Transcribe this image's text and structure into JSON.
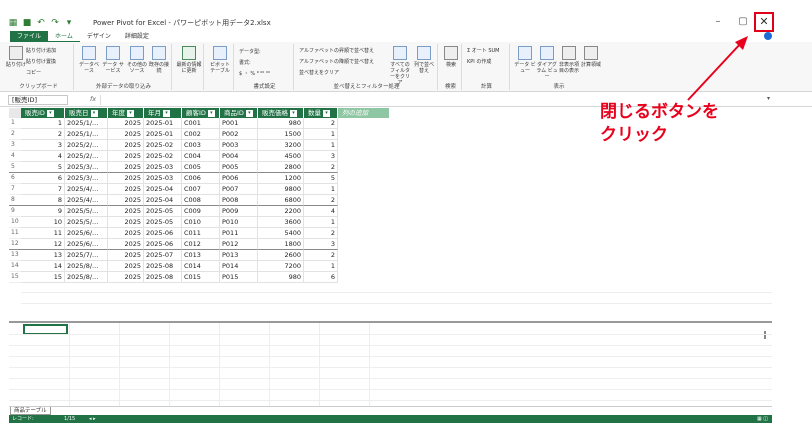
{
  "window": {
    "title": "Power Pivot for Excel - パワーピボット用データ2.xlsx",
    "minimize": "–",
    "restore": "▢",
    "close": "✕"
  },
  "tabs": [
    "ファイル",
    "ホーム",
    "デザイン",
    "詳細設定"
  ],
  "ribbon": {
    "clipboard": {
      "paste": "貼り付け",
      "append": "貼り付け追加",
      "replace": "貼り付け置換",
      "copy": "コピー",
      "label": "クリップボード"
    },
    "external": {
      "db": "データベース",
      "service": "データ サービス",
      "other": "その他のソース",
      "existing": "既存の接続",
      "label": "外部データの取り込み"
    },
    "refresh": {
      "label": "最新の情報に更新"
    },
    "pivot": {
      "label": "ピボットテーブル"
    },
    "format": {
      "type": "データ型:",
      "fmt": "書式:",
      "currency": "$ ・ % ⁹ ⁰⁰ ⁰⁰",
      "label": "書式設定"
    },
    "sort": {
      "asc": "アルファベットの昇順で並べ替え",
      "desc": "アルファベットの降順で並べ替え",
      "clear": "並べ替えをクリア",
      "filter": "すべてのフィルターをクリア",
      "bycol": "列で並べ替え",
      "label": "並べ替えとフィルター処理"
    },
    "find": {
      "btn": "検索",
      "label": "検索"
    },
    "calc": {
      "autosum": "オート SUM",
      "kpi": "KPI の作成",
      "label": "計算"
    },
    "view": {
      "data": "データ ビュー",
      "diagram": "ダイアグラム ビュー",
      "hidden": "非表示項目の表示",
      "area": "計算領域",
      "label": "表示"
    }
  },
  "formula": {
    "name_box": "[販売ID]",
    "fx": "fx"
  },
  "table": {
    "headers": [
      "販売ID",
      "販売日",
      "年度",
      "年月",
      "顧客ID",
      "商品ID",
      "販売価格",
      "数量",
      "列の追加"
    ],
    "rows": [
      [
        "1",
        "1",
        "2025/1/...",
        "2025",
        "2025-01",
        "C001",
        "P001",
        "980",
        "2"
      ],
      [
        "2",
        "2",
        "2025/1/...",
        "2025",
        "2025-01",
        "C002",
        "P002",
        "1500",
        "1"
      ],
      [
        "3",
        "3",
        "2025/2/...",
        "2025",
        "2025-02",
        "C003",
        "P003",
        "3200",
        "1"
      ],
      [
        "4",
        "4",
        "2025/2/...",
        "2025",
        "2025-02",
        "C004",
        "P004",
        "4500",
        "3"
      ],
      [
        "5",
        "5",
        "2025/3/...",
        "2025",
        "2025-03",
        "C005",
        "P005",
        "2800",
        "2"
      ],
      [
        "6",
        "6",
        "2025/3/...",
        "2025",
        "2025-03",
        "C006",
        "P006",
        "1200",
        "5"
      ],
      [
        "7",
        "7",
        "2025/4/...",
        "2025",
        "2025-04",
        "C007",
        "P007",
        "9800",
        "1"
      ],
      [
        "8",
        "8",
        "2025/4/...",
        "2025",
        "2025-04",
        "C008",
        "P008",
        "6800",
        "2"
      ],
      [
        "9",
        "9",
        "2025/5/...",
        "2025",
        "2025-05",
        "C009",
        "P009",
        "2200",
        "4"
      ],
      [
        "10",
        "10",
        "2025/5/...",
        "2025",
        "2025-05",
        "C010",
        "P010",
        "3600",
        "1"
      ],
      [
        "11",
        "11",
        "2025/6/...",
        "2025",
        "2025-06",
        "C011",
        "P011",
        "5400",
        "2"
      ],
      [
        "12",
        "12",
        "2025/6/...",
        "2025",
        "2025-06",
        "C012",
        "P012",
        "1800",
        "3"
      ],
      [
        "13",
        "13",
        "2025/7/...",
        "2025",
        "2025-07",
        "C013",
        "P013",
        "2600",
        "2"
      ],
      [
        "14",
        "14",
        "2025/8/...",
        "2025",
        "2025-08",
        "C014",
        "P014",
        "7200",
        "1"
      ],
      [
        "15",
        "15",
        "2025/8/...",
        "2025",
        "2025-08",
        "C015",
        "P015",
        "980",
        "6"
      ]
    ]
  },
  "annotation": {
    "line1": "閉じるボタンを",
    "line2": "クリック",
    "color": "#e8001c"
  },
  "sheet_tab": "商品テーブル",
  "status": {
    "record": "レコード:",
    "count": "1/15",
    "nav": "◂ ▸"
  },
  "colors": {
    "accent": "#217346",
    "highlight": "#e0001a"
  }
}
